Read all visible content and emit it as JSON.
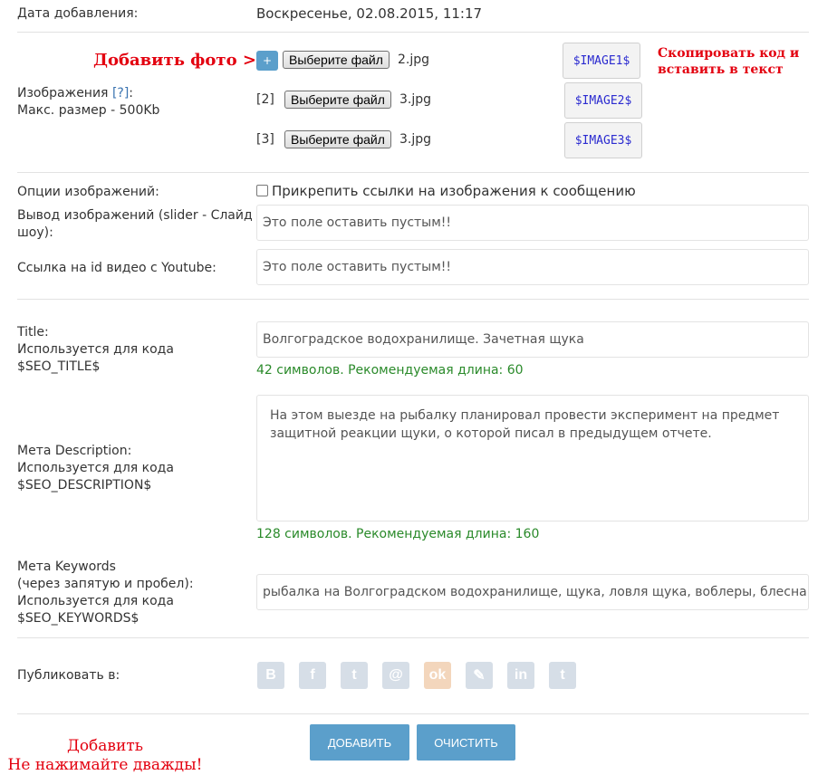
{
  "date_row": {
    "label": "Дата добавления:",
    "value": "Воскресенье, 02.08.2015, 11:17"
  },
  "images": {
    "add_photo_note": "Добавить фото >",
    "copy_note_line1": "Скопировать код и",
    "copy_note_line2": "вставить в текст",
    "label_line1": "Изображения",
    "label_help": "[?]",
    "label_colon": ":",
    "label_line2": "Макс. размер - 500Kb",
    "add_button": "+",
    "rows": [
      {
        "index": "",
        "button": "Выберите файл",
        "file": "2.jpg",
        "code": "$IMAGE1$"
      },
      {
        "index": "[2]",
        "button": "Выберите файл",
        "file": "3.jpg",
        "code": "$IMAGE2$"
      },
      {
        "index": "[3]",
        "button": "Выберите файл",
        "file": "3.jpg",
        "code": "$IMAGE3$"
      }
    ]
  },
  "image_options": {
    "label": "Опции изображений:",
    "checkbox_label": "Прикрепить ссылки на изображения к сообщению",
    "checked": false
  },
  "slider": {
    "label_line1": "Вывод изображений (slider - Слайд",
    "label_line2": "шоу):",
    "value": "Это поле оставить пустым!!"
  },
  "youtube": {
    "label": "Ссылка на id видео с Youtube:",
    "value": "Это поле оставить пустым!!"
  },
  "seo_title": {
    "label_line1": "Title:",
    "label_line2": "Используется для кода",
    "label_line3": "$SEO_TITLE$",
    "value": "Волгоградское водохранилище. Зачетная щука",
    "hint": "42 символов. Рекомендуемая длина: 60"
  },
  "seo_description": {
    "label_line1": "Мета Description:",
    "label_line2": "Используется для кода",
    "label_line3": "$SEO_DESCRIPTION$",
    "value_line1": "На этом выезде на рыбалку планировал провести эксперимент на предмет",
    "value_line2": "защитной реакции щуки, о которой писал в предыдущем отчете.",
    "hint": "128 символов. Рекомендуемая длина: 160"
  },
  "seo_keywords": {
    "label_line1": "Мета Keywords",
    "label_line2": "(через запятую и пробел):",
    "label_line3": "Используется для кода",
    "label_line4": "$SEO_KEYWORDS$",
    "value": "рыбалка на Волгоградском водохранилище, щука, ловля щука, воблеры, блесна"
  },
  "publish": {
    "label": "Публиковать в:",
    "networks": [
      {
        "icon": "vk-icon",
        "glyph": "B"
      },
      {
        "icon": "facebook-icon",
        "glyph": "f"
      },
      {
        "icon": "twitter-icon",
        "glyph": "t"
      },
      {
        "icon": "email-icon",
        "glyph": "@"
      },
      {
        "icon": "odnoklassniki-icon",
        "glyph": "ok"
      },
      {
        "icon": "livejournal-icon",
        "glyph": "✎"
      },
      {
        "icon": "linkedin-icon",
        "glyph": "in"
      },
      {
        "icon": "tumblr-icon",
        "glyph": "t"
      }
    ]
  },
  "actions": {
    "submit": "ДОБАВИТЬ",
    "reset": "ОЧИСТИТЬ"
  },
  "footer_note": {
    "line1": "Добавить",
    "line2": "Не нажимайте дважды!"
  },
  "colors": {
    "accent_button": "#5b9fcb",
    "hint_green": "#2a8a2a",
    "note_red": "#e3000f",
    "code_blue": "#2b2bd0"
  }
}
